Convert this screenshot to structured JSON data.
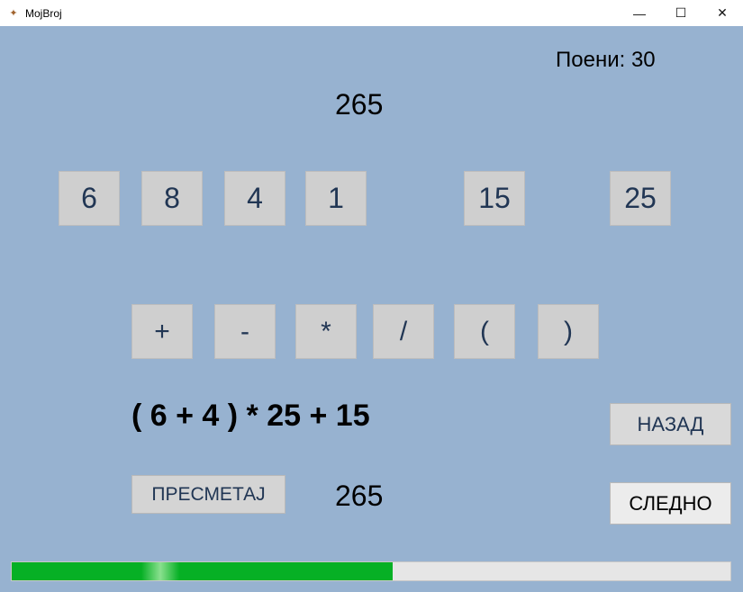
{
  "window": {
    "title": "MojBroj"
  },
  "score": "Поени: 30",
  "target": "265",
  "numbers": [
    "6",
    "8",
    "4",
    "1",
    "15",
    "25"
  ],
  "operators": [
    "+",
    "-",
    "*",
    "/",
    "(",
    ")"
  ],
  "expression": "( 6 + 4 ) * 25 + 15",
  "buttons": {
    "calculate": "ПРЕСМЕТАЈ",
    "back": "НАЗАД",
    "next": "СЛЕДНО"
  },
  "result": "265",
  "progress": {
    "fraction": 0.53
  },
  "colors": {
    "background": "#97b2d0",
    "progress": "#06b025"
  }
}
